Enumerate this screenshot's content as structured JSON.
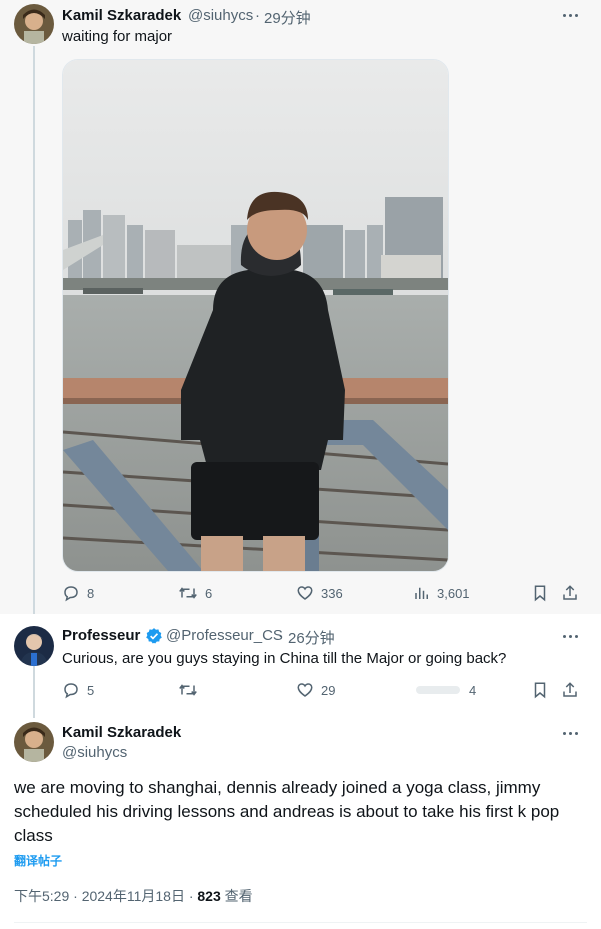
{
  "tweet1": {
    "name": "Kamil Szkaradek",
    "handle": "@siuhycs",
    "dot": "·",
    "time": "29分钟",
    "text": "waiting for major",
    "replies": "8",
    "retweets": "6",
    "likes": "336",
    "views": "3,601"
  },
  "tweet2": {
    "name": "Professeur",
    "handle": "@Professeur_CS",
    "dot": "·",
    "time": "26分钟",
    "text": "Curious, are you guys staying in China till the Major or going back?",
    "replies": "5",
    "likes": "29",
    "views": "4"
  },
  "tweet3": {
    "name": "Kamil Szkaradek",
    "handle": "@siuhycs",
    "text": "we are moving to shanghai, dennis already joined a yoga class, jimmy scheduled his driving lessons and andreas is about to take his first k pop class",
    "translate": "翻译帖子",
    "time": "下午5:29 · 2024年11月18日 · ",
    "views_count": "823",
    "views_label": " 查看"
  },
  "colors": {
    "accent": "#1d9bf0",
    "muted": "#536471",
    "text": "#0f1419"
  },
  "icons": [
    "reply-icon",
    "retweet-icon",
    "like-icon",
    "views-icon",
    "bookmark-icon",
    "share-icon",
    "more-icon",
    "verified-badge-icon"
  ]
}
